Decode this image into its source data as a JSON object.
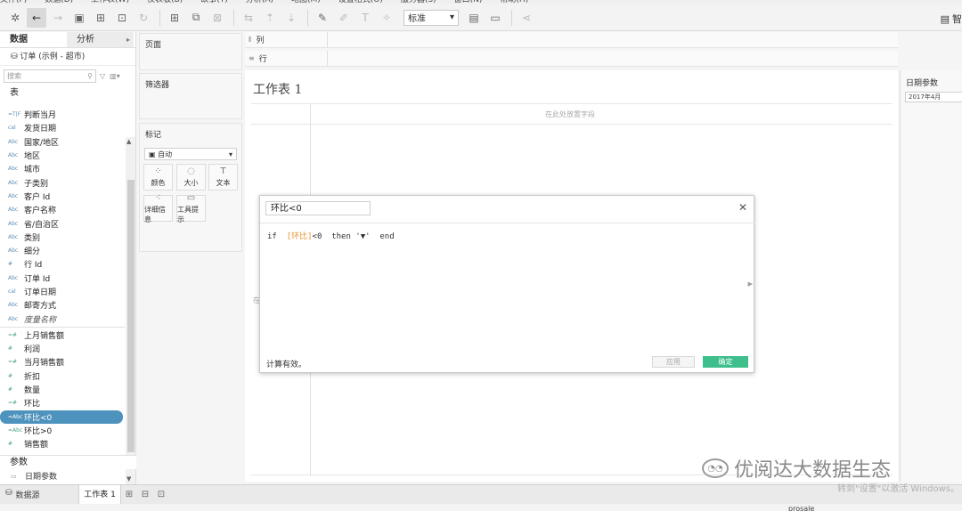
{
  "toolbar": {
    "style_select": "标准"
  },
  "left": {
    "tab_data": "数据",
    "tab_analysis": "分析",
    "datasource": "订单 (示例 - 超市)",
    "search_placeholder": "搜索",
    "section_table": "表",
    "dimensions": [
      {
        "icon": "=T|F",
        "label": "判断当月"
      },
      {
        "icon": "cal",
        "label": "发货日期"
      },
      {
        "icon": "Abc",
        "label": "国家/地区"
      },
      {
        "icon": "Abc",
        "label": "地区"
      },
      {
        "icon": "Abc",
        "label": "城市"
      },
      {
        "icon": "Abc",
        "label": "子类别"
      },
      {
        "icon": "Abc",
        "label": "客户 Id"
      },
      {
        "icon": "Abc",
        "label": "客户名称"
      },
      {
        "icon": "Abc",
        "label": "省/自治区"
      },
      {
        "icon": "Abc",
        "label": "类别"
      },
      {
        "icon": "Abc",
        "label": "细分"
      },
      {
        "icon": "#",
        "label": "行 Id"
      },
      {
        "icon": "Abc",
        "label": "订单 Id"
      },
      {
        "icon": "cal",
        "label": "订单日期"
      },
      {
        "icon": "Abc",
        "label": "邮寄方式"
      },
      {
        "icon": "Abc",
        "label": "度量名称"
      }
    ],
    "measures": [
      {
        "icon": "=#",
        "label": "上月销售额"
      },
      {
        "icon": "#",
        "label": "利润"
      },
      {
        "icon": "=#",
        "label": "当月销售额"
      },
      {
        "icon": "#",
        "label": "折扣"
      },
      {
        "icon": "#",
        "label": "数量"
      },
      {
        "icon": "=#",
        "label": "环比"
      },
      {
        "icon": "=Abc",
        "label": "环比<0"
      },
      {
        "icon": "=Abc",
        "label": "环比>0"
      },
      {
        "icon": "#",
        "label": "销售额"
      }
    ],
    "section_params": "参数",
    "param_field": "日期参数"
  },
  "shelves": {
    "pages": "页面",
    "filters": "筛选器",
    "marks": "标记",
    "marks_type": "自动",
    "mark_color": "颜色",
    "mark_size": "大小",
    "mark_text": "文本",
    "mark_detail": "详细信息",
    "mark_tooltip": "工具提示",
    "columns": "列",
    "rows": "行"
  },
  "worksheet": {
    "title": "工作表 1",
    "drop_col": "在此处放置字段",
    "drop_row": "在"
  },
  "param_card": {
    "title": "日期参数",
    "value": "2017年4月"
  },
  "dialog": {
    "name": "环比<0",
    "code_if": "if  ",
    "code_field": "[环比]",
    "code_rest": "<0  then '▼'  end",
    "status": "计算有效。",
    "apply": "应用",
    "ok": "确定"
  },
  "bottom": {
    "datasource_tab": "数据源",
    "sheet_tab": "工作表 1",
    "user": "prosale"
  },
  "watermark": {
    "text": "优阅达大数据生态",
    "windows": "转到\"设置\"以激活 Windows。"
  }
}
